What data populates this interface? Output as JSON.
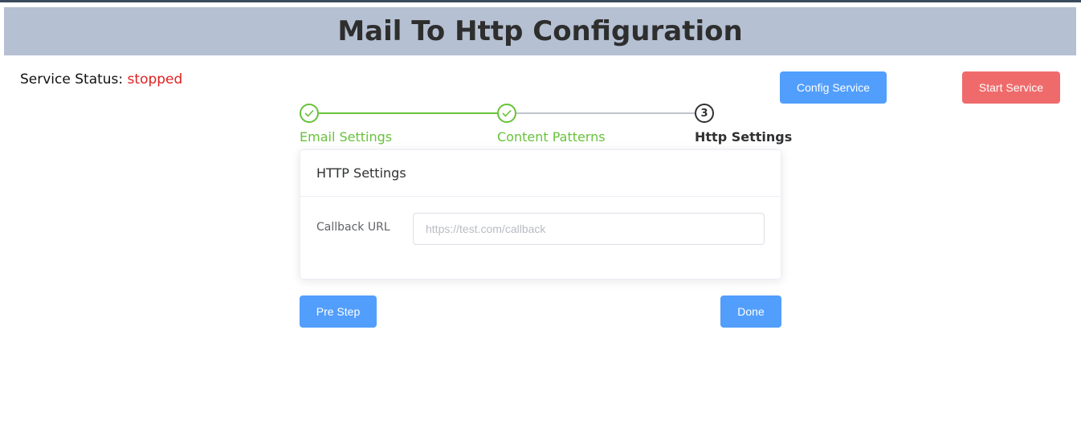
{
  "header": {
    "title": "Mail To Http Configuration"
  },
  "status": {
    "label": "Service Status:",
    "value": "stopped"
  },
  "actions": {
    "config_label": "Config Service",
    "start_label": "Start Service"
  },
  "steps": [
    {
      "number": "1",
      "title": "Email Settings",
      "state": "done"
    },
    {
      "number": "2",
      "title": "Content Patterns",
      "state": "done"
    },
    {
      "number": "3",
      "title": "Http Settings",
      "state": "active"
    }
  ],
  "card": {
    "title": "HTTP Settings",
    "callback_label": "Callback URL",
    "callback_value": "",
    "callback_placeholder": "https://test.com/callback"
  },
  "nav": {
    "pre_label": "Pre Step",
    "done_label": "Done"
  },
  "colors": {
    "header_bg": "#b5c0d2",
    "primary": "#529efd",
    "danger": "#ef6b6b",
    "success": "#67c23a",
    "status_stopped": "#e02020"
  }
}
